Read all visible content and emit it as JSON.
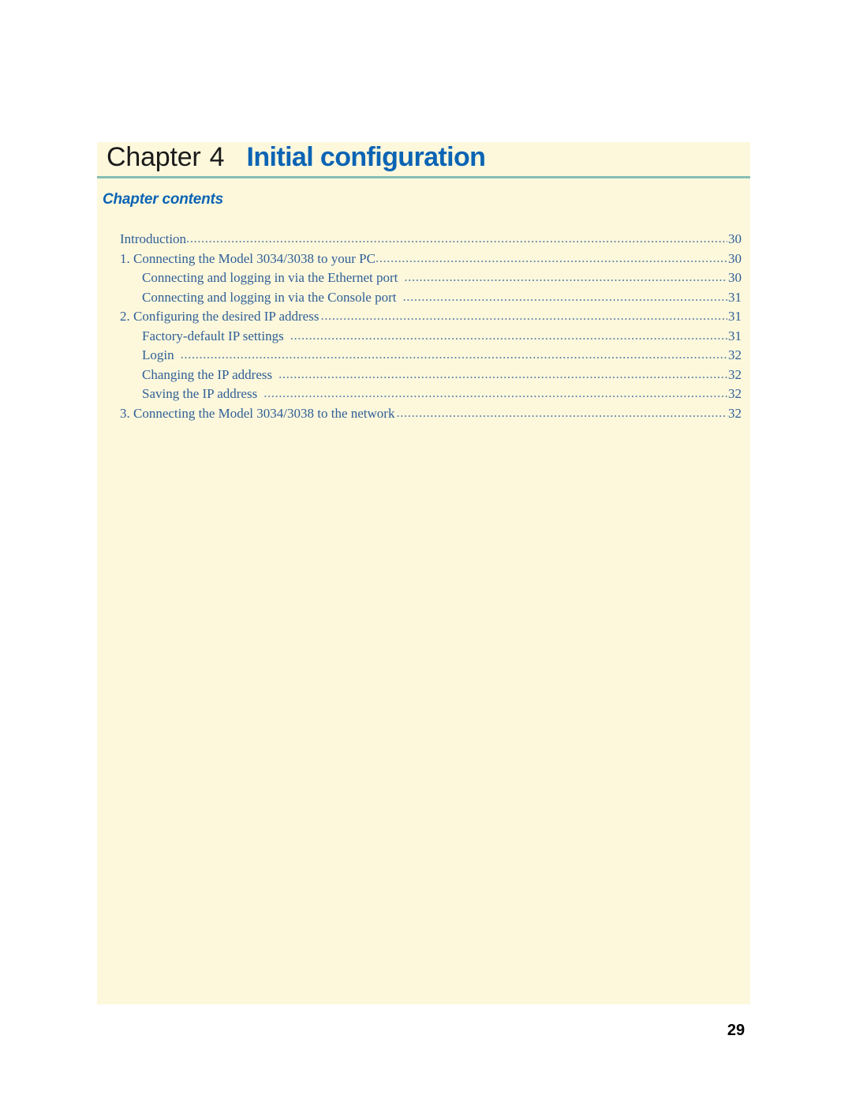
{
  "page": {
    "folio": "29",
    "background_color": "#ffffff",
    "panel_color": "#fdf8dc",
    "accent_blue": "#0b64b4",
    "rule_color": "#86bfb4",
    "toc_text_color": "#2f5f97"
  },
  "chapter_header": {
    "label": "Chapter",
    "number": "4",
    "title": "Initial configuration"
  },
  "contents": {
    "heading": "Chapter contents",
    "entries": [
      {
        "title": "Introduction",
        "page": "30",
        "level": 0,
        "gap": "none"
      },
      {
        "title": "1. Connecting the Model 3034/3038 to your PC",
        "page": "30",
        "level": 0,
        "gap": "none"
      },
      {
        "title": "Connecting and logging in via the Ethernet port",
        "page": "30",
        "level": 1,
        "gap": "wide"
      },
      {
        "title": "Connecting and logging in via the Console port",
        "page": "31",
        "level": 1,
        "gap": "wide"
      },
      {
        "title": "2. Configuring the desired IP address",
        "page": "31",
        "level": 0,
        "gap": "small"
      },
      {
        "title": "Factory-default IP settings",
        "page": "31",
        "level": 1,
        "gap": "wide"
      },
      {
        "title": "Login",
        "page": "32",
        "level": 1,
        "gap": "wide"
      },
      {
        "title": "Changing the IP address",
        "page": "32",
        "level": 1,
        "gap": "wide"
      },
      {
        "title": "Saving the IP address",
        "page": "32",
        "level": 1,
        "gap": "wide"
      },
      {
        "title": "3. Connecting the Model 3034/3038 to the network",
        "page": "32",
        "level": 0,
        "gap": "small"
      }
    ]
  }
}
